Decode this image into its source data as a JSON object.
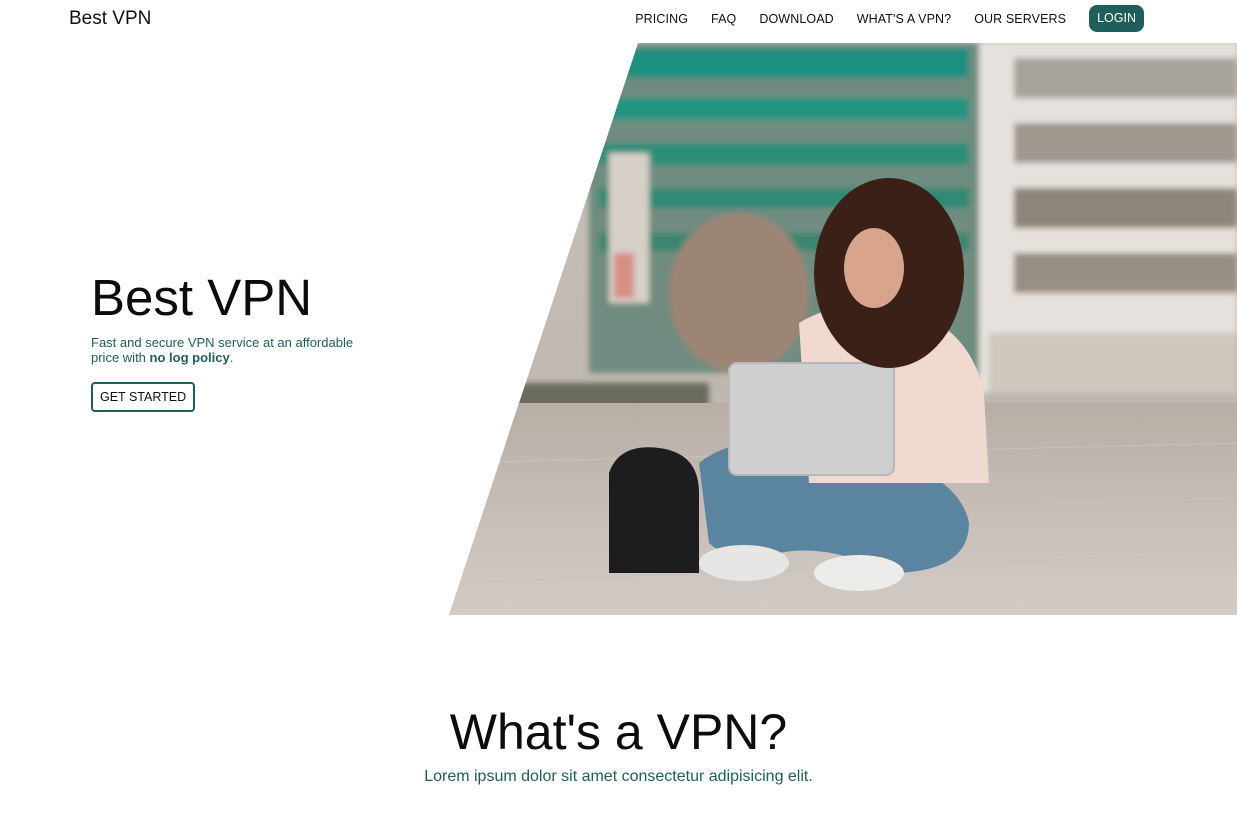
{
  "nav": {
    "brand": "Best VPN",
    "items": [
      {
        "label": "PRICING"
      },
      {
        "label": "FAQ"
      },
      {
        "label": "DOWNLOAD"
      },
      {
        "label": "WHAT'S A VPN?"
      },
      {
        "label": "OUR SERVERS"
      }
    ],
    "login": "LOGIN"
  },
  "hero": {
    "title": "Best VPN",
    "subtitle_pre": "Fast and secure VPN service at an affordable price with ",
    "subtitle_bold": "no log policy",
    "subtitle_post": ".",
    "cta": "GET STARTED",
    "image_description_icon": "hero-photo"
  },
  "section": {
    "title": "What's a VPN?",
    "subtitle": "Lorem ipsum dolor sit amet consectetur adipisicing elit."
  },
  "colors": {
    "accent": "#1f5f5b",
    "text": "#111111",
    "background": "#ffffff"
  }
}
